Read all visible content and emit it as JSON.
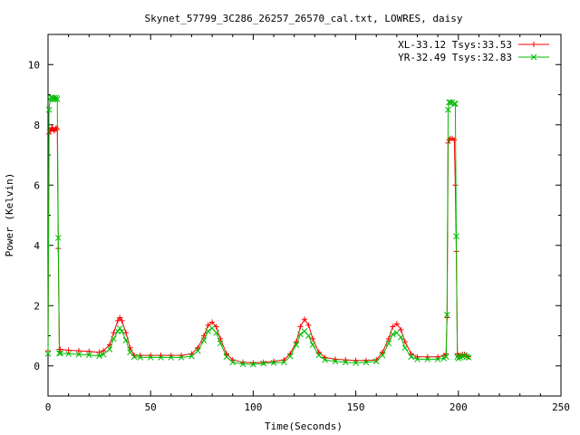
{
  "chart_data": {
    "type": "line",
    "title": "Skynet_57799_3C286_26257_26570_cal.txt, LOWRES, daisy",
    "xlabel": "Time(Seconds)",
    "ylabel": "Power (Kelvin)",
    "xlim": [
      0,
      250
    ],
    "ylim": [
      -1,
      11
    ],
    "xticks": [
      "0",
      "50",
      "100",
      "150",
      "200",
      "250"
    ],
    "yticks": [
      "0",
      "2",
      "4",
      "6",
      "8",
      "10"
    ],
    "grid": false,
    "legend_position": "top-right",
    "series": [
      {
        "name": "XL-33.12 Tsys:33.53",
        "color": "#ff0000",
        "marker": "plus",
        "x": [
          0,
          0.5,
          1,
          1.5,
          2,
          2.5,
          3,
          3.5,
          4,
          4.5,
          5,
          5.5,
          6,
          10,
          15,
          20,
          25,
          27,
          30,
          32,
          34,
          35,
          36,
          38,
          40,
          42,
          45,
          50,
          55,
          60,
          65,
          70,
          73,
          76,
          78,
          80,
          82,
          84,
          87,
          90,
          95,
          100,
          105,
          110,
          115,
          118,
          121,
          123,
          125,
          127,
          129,
          132,
          135,
          140,
          145,
          150,
          155,
          160,
          163,
          166,
          168,
          170,
          172,
          174,
          177,
          180,
          185,
          190,
          193,
          194,
          194.5,
          195,
          195.5,
          196,
          197,
          198,
          198.5,
          199,
          199.5,
          200,
          201,
          202,
          203,
          204,
          205
        ],
        "y": [
          0.5,
          7.7,
          7.8,
          7.85,
          7.9,
          7.85,
          7.8,
          7.85,
          7.9,
          7.85,
          3.9,
          0.55,
          0.55,
          0.52,
          0.5,
          0.48,
          0.45,
          0.5,
          0.7,
          1.1,
          1.5,
          1.6,
          1.5,
          1.1,
          0.6,
          0.35,
          0.35,
          0.35,
          0.35,
          0.35,
          0.35,
          0.4,
          0.6,
          1.0,
          1.35,
          1.45,
          1.3,
          0.9,
          0.4,
          0.2,
          0.12,
          0.1,
          0.12,
          0.15,
          0.2,
          0.4,
          0.8,
          1.3,
          1.55,
          1.35,
          0.9,
          0.45,
          0.28,
          0.22,
          0.2,
          0.18,
          0.18,
          0.2,
          0.45,
          0.9,
          1.3,
          1.4,
          1.2,
          0.8,
          0.4,
          0.3,
          0.3,
          0.3,
          0.35,
          0.4,
          1.6,
          7.4,
          7.5,
          7.55,
          7.55,
          7.5,
          6.0,
          3.8,
          0.4,
          0.35,
          0.35,
          0.38,
          0.38,
          0.35,
          0.3
        ]
      },
      {
        "name": "YR-32.49 Tsys:32.83",
        "color": "#00bb00",
        "marker": "cross",
        "x": [
          0,
          0.5,
          1,
          1.5,
          2,
          2.5,
          3,
          3.5,
          4,
          4.5,
          5,
          5.5,
          6,
          10,
          15,
          20,
          25,
          27,
          30,
          32,
          34,
          35,
          36,
          38,
          40,
          42,
          45,
          50,
          55,
          60,
          65,
          70,
          73,
          76,
          78,
          80,
          82,
          84,
          87,
          90,
          95,
          100,
          105,
          110,
          115,
          118,
          121,
          123,
          125,
          127,
          129,
          132,
          135,
          140,
          145,
          150,
          155,
          160,
          163,
          166,
          168,
          170,
          172,
          174,
          177,
          180,
          185,
          190,
          193,
          194,
          194.5,
          195,
          195.5,
          196,
          197,
          198,
          198.5,
          199,
          199.5,
          200,
          201,
          202,
          203,
          204,
          205
        ],
        "y": [
          0.4,
          8.5,
          8.85,
          8.9,
          8.9,
          8.85,
          8.9,
          8.85,
          8.9,
          8.85,
          4.25,
          0.42,
          0.42,
          0.4,
          0.38,
          0.36,
          0.33,
          0.38,
          0.55,
          0.9,
          1.15,
          1.25,
          1.15,
          0.85,
          0.45,
          0.3,
          0.28,
          0.28,
          0.28,
          0.28,
          0.28,
          0.32,
          0.5,
          0.85,
          1.15,
          1.25,
          1.1,
          0.75,
          0.3,
          0.12,
          0.06,
          0.05,
          0.08,
          0.1,
          0.12,
          0.32,
          0.7,
          1.05,
          1.15,
          1.0,
          0.7,
          0.35,
          0.2,
          0.15,
          0.12,
          0.1,
          0.12,
          0.15,
          0.35,
          0.75,
          1.05,
          1.1,
          0.95,
          0.6,
          0.3,
          0.22,
          0.22,
          0.22,
          0.25,
          0.3,
          1.7,
          8.5,
          8.75,
          8.75,
          8.75,
          8.7,
          8.7,
          4.3,
          0.3,
          0.25,
          0.28,
          0.32,
          0.35,
          0.3,
          0.28
        ]
      }
    ]
  }
}
